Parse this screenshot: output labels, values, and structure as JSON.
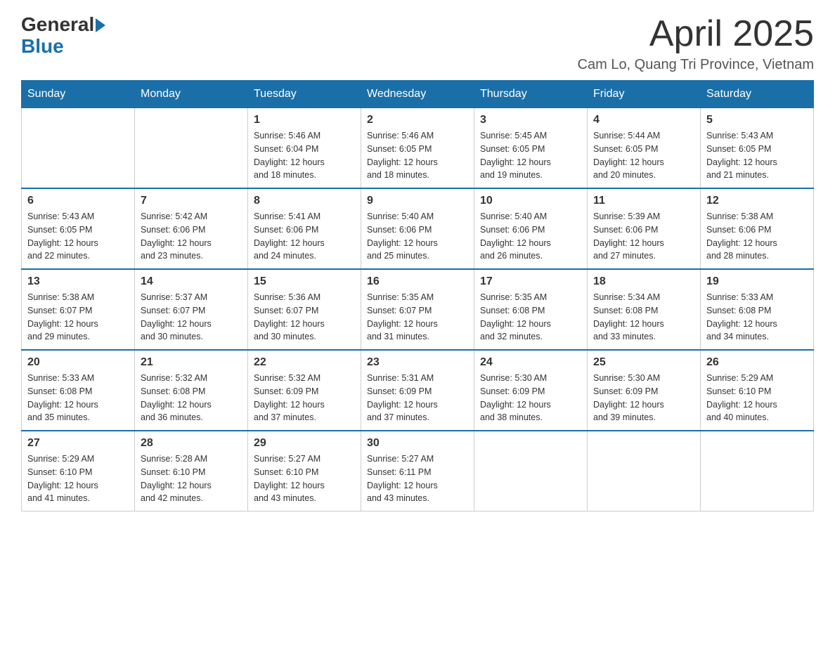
{
  "header": {
    "logo": {
      "general": "General",
      "blue": "Blue"
    },
    "title": "April 2025",
    "location": "Cam Lo, Quang Tri Province, Vietnam"
  },
  "weekdays": [
    "Sunday",
    "Monday",
    "Tuesday",
    "Wednesday",
    "Thursday",
    "Friday",
    "Saturday"
  ],
  "weeks": [
    [
      {
        "day": "",
        "info": ""
      },
      {
        "day": "",
        "info": ""
      },
      {
        "day": "1",
        "info": "Sunrise: 5:46 AM\nSunset: 6:04 PM\nDaylight: 12 hours\nand 18 minutes."
      },
      {
        "day": "2",
        "info": "Sunrise: 5:46 AM\nSunset: 6:05 PM\nDaylight: 12 hours\nand 18 minutes."
      },
      {
        "day": "3",
        "info": "Sunrise: 5:45 AM\nSunset: 6:05 PM\nDaylight: 12 hours\nand 19 minutes."
      },
      {
        "day": "4",
        "info": "Sunrise: 5:44 AM\nSunset: 6:05 PM\nDaylight: 12 hours\nand 20 minutes."
      },
      {
        "day": "5",
        "info": "Sunrise: 5:43 AM\nSunset: 6:05 PM\nDaylight: 12 hours\nand 21 minutes."
      }
    ],
    [
      {
        "day": "6",
        "info": "Sunrise: 5:43 AM\nSunset: 6:05 PM\nDaylight: 12 hours\nand 22 minutes."
      },
      {
        "day": "7",
        "info": "Sunrise: 5:42 AM\nSunset: 6:06 PM\nDaylight: 12 hours\nand 23 minutes."
      },
      {
        "day": "8",
        "info": "Sunrise: 5:41 AM\nSunset: 6:06 PM\nDaylight: 12 hours\nand 24 minutes."
      },
      {
        "day": "9",
        "info": "Sunrise: 5:40 AM\nSunset: 6:06 PM\nDaylight: 12 hours\nand 25 minutes."
      },
      {
        "day": "10",
        "info": "Sunrise: 5:40 AM\nSunset: 6:06 PM\nDaylight: 12 hours\nand 26 minutes."
      },
      {
        "day": "11",
        "info": "Sunrise: 5:39 AM\nSunset: 6:06 PM\nDaylight: 12 hours\nand 27 minutes."
      },
      {
        "day": "12",
        "info": "Sunrise: 5:38 AM\nSunset: 6:06 PM\nDaylight: 12 hours\nand 28 minutes."
      }
    ],
    [
      {
        "day": "13",
        "info": "Sunrise: 5:38 AM\nSunset: 6:07 PM\nDaylight: 12 hours\nand 29 minutes."
      },
      {
        "day": "14",
        "info": "Sunrise: 5:37 AM\nSunset: 6:07 PM\nDaylight: 12 hours\nand 30 minutes."
      },
      {
        "day": "15",
        "info": "Sunrise: 5:36 AM\nSunset: 6:07 PM\nDaylight: 12 hours\nand 30 minutes."
      },
      {
        "day": "16",
        "info": "Sunrise: 5:35 AM\nSunset: 6:07 PM\nDaylight: 12 hours\nand 31 minutes."
      },
      {
        "day": "17",
        "info": "Sunrise: 5:35 AM\nSunset: 6:08 PM\nDaylight: 12 hours\nand 32 minutes."
      },
      {
        "day": "18",
        "info": "Sunrise: 5:34 AM\nSunset: 6:08 PM\nDaylight: 12 hours\nand 33 minutes."
      },
      {
        "day": "19",
        "info": "Sunrise: 5:33 AM\nSunset: 6:08 PM\nDaylight: 12 hours\nand 34 minutes."
      }
    ],
    [
      {
        "day": "20",
        "info": "Sunrise: 5:33 AM\nSunset: 6:08 PM\nDaylight: 12 hours\nand 35 minutes."
      },
      {
        "day": "21",
        "info": "Sunrise: 5:32 AM\nSunset: 6:08 PM\nDaylight: 12 hours\nand 36 minutes."
      },
      {
        "day": "22",
        "info": "Sunrise: 5:32 AM\nSunset: 6:09 PM\nDaylight: 12 hours\nand 37 minutes."
      },
      {
        "day": "23",
        "info": "Sunrise: 5:31 AM\nSunset: 6:09 PM\nDaylight: 12 hours\nand 37 minutes."
      },
      {
        "day": "24",
        "info": "Sunrise: 5:30 AM\nSunset: 6:09 PM\nDaylight: 12 hours\nand 38 minutes."
      },
      {
        "day": "25",
        "info": "Sunrise: 5:30 AM\nSunset: 6:09 PM\nDaylight: 12 hours\nand 39 minutes."
      },
      {
        "day": "26",
        "info": "Sunrise: 5:29 AM\nSunset: 6:10 PM\nDaylight: 12 hours\nand 40 minutes."
      }
    ],
    [
      {
        "day": "27",
        "info": "Sunrise: 5:29 AM\nSunset: 6:10 PM\nDaylight: 12 hours\nand 41 minutes."
      },
      {
        "day": "28",
        "info": "Sunrise: 5:28 AM\nSunset: 6:10 PM\nDaylight: 12 hours\nand 42 minutes."
      },
      {
        "day": "29",
        "info": "Sunrise: 5:27 AM\nSunset: 6:10 PM\nDaylight: 12 hours\nand 43 minutes."
      },
      {
        "day": "30",
        "info": "Sunrise: 5:27 AM\nSunset: 6:11 PM\nDaylight: 12 hours\nand 43 minutes."
      },
      {
        "day": "",
        "info": ""
      },
      {
        "day": "",
        "info": ""
      },
      {
        "day": "",
        "info": ""
      }
    ]
  ]
}
